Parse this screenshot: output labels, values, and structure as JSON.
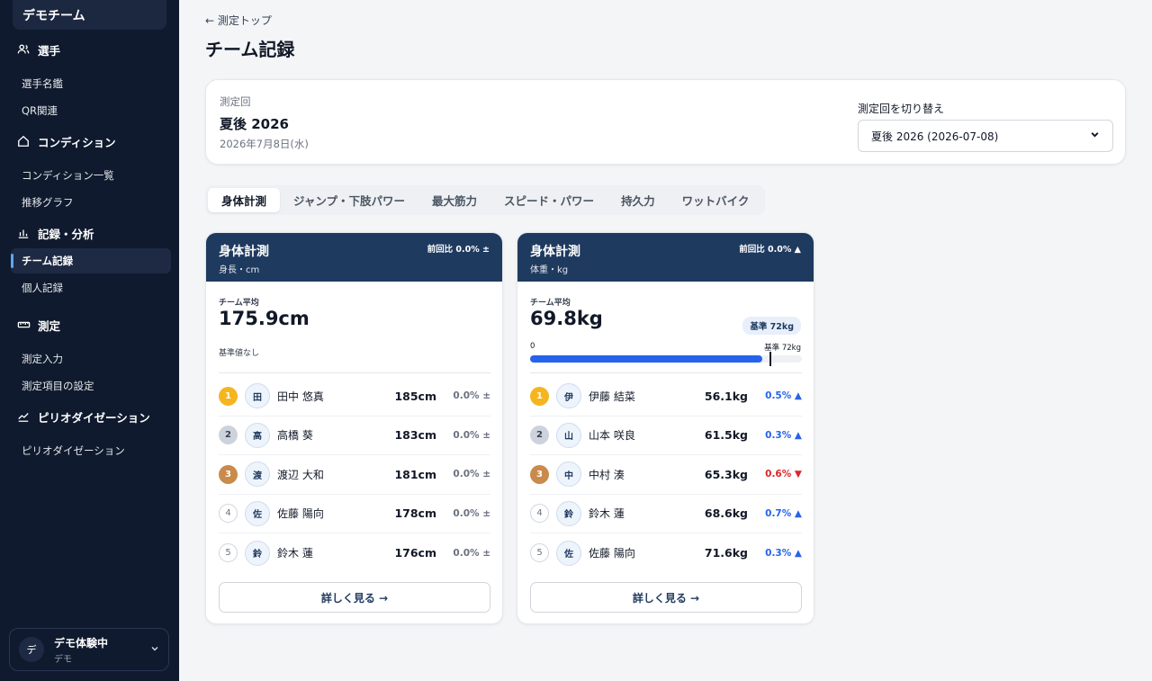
{
  "team": {
    "name": "デモチーム"
  },
  "nav": {
    "sections": [
      {
        "title": "選手",
        "icon": "users-icon",
        "items": [
          "選手名鑑",
          "QR関連"
        ]
      },
      {
        "title": "コンディション",
        "icon": "home-icon",
        "items": [
          "コンディション一覧",
          "推移グラフ"
        ]
      },
      {
        "title": "記録・分析",
        "icon": "bar-chart-icon",
        "items": [
          "チーム記録",
          "個人記録"
        ]
      },
      {
        "title": "測定",
        "icon": "ruler-icon",
        "items": [
          "測定入力",
          "測定項目の設定"
        ]
      },
      {
        "title": "ピリオダイゼーション",
        "icon": "trend-chart-icon",
        "items": [
          "ピリオダイゼーション"
        ]
      }
    ],
    "active_item": "チーム記録"
  },
  "user": {
    "avatar": "デ",
    "name": "デモ体験中",
    "role": "デモ"
  },
  "page": {
    "back_link": "← 測定トップ",
    "title": "チーム記録"
  },
  "session": {
    "label": "測定回",
    "name": "夏後 2026",
    "date": "2026年7月8日(水)",
    "switch_label": "測定回を切り替え",
    "selected": "夏後 2026 (2026-07-08)"
  },
  "tabs": [
    "身体計測",
    "ジャンプ・下肢パワー",
    "最大筋力",
    "スピード・パワー",
    "持久力",
    "ワットバイク"
  ],
  "active_tab": "身体計測",
  "cards": [
    {
      "title": "身体計測",
      "subtitle": "身長・cm",
      "prev_diff": "前回比 0.0% ±",
      "avg_label": "チーム平均",
      "avg_value": "175.9cm",
      "no_standard": "基準値なし",
      "ranking": [
        {
          "rank": "1",
          "initial": "田",
          "name": "田中 悠真",
          "value": "185cm",
          "diff": "0.0% ±",
          "trend": "neutral"
        },
        {
          "rank": "2",
          "initial": "高",
          "name": "高橋 葵",
          "value": "183cm",
          "diff": "0.0% ±",
          "trend": "neutral"
        },
        {
          "rank": "3",
          "initial": "渡",
          "name": "渡辺 大和",
          "value": "181cm",
          "diff": "0.0% ±",
          "trend": "neutral"
        },
        {
          "rank": "4",
          "initial": "佐",
          "name": "佐藤 陽向",
          "value": "178cm",
          "diff": "0.0% ±",
          "trend": "neutral"
        },
        {
          "rank": "5",
          "initial": "鈴",
          "name": "鈴木 蓮",
          "value": "176cm",
          "diff": "0.0% ±",
          "trend": "neutral"
        }
      ],
      "detail_button": "詳しく見る →"
    },
    {
      "title": "身体計測",
      "subtitle": "体重・kg",
      "prev_diff": "前回比 0.0% ▲",
      "avg_label": "チーム平均",
      "avg_value": "69.8kg",
      "standard_badge": "基準 72kg",
      "bar": {
        "min_label": "0",
        "standard_label": "基準 72kg",
        "fill_fraction": 0.855,
        "standard_fraction": 0.882
      },
      "ranking": [
        {
          "rank": "1",
          "initial": "伊",
          "name": "伊藤 結菜",
          "value": "56.1kg",
          "diff": "0.5% ▲",
          "trend": "up"
        },
        {
          "rank": "2",
          "initial": "山",
          "name": "山本 咲良",
          "value": "61.5kg",
          "diff": "0.3% ▲",
          "trend": "up"
        },
        {
          "rank": "3",
          "initial": "中",
          "name": "中村 湊",
          "value": "65.3kg",
          "diff": "0.6% ▼",
          "trend": "down"
        },
        {
          "rank": "4",
          "initial": "鈴",
          "name": "鈴木 蓮",
          "value": "68.6kg",
          "diff": "0.7% ▲",
          "trend": "up"
        },
        {
          "rank": "5",
          "initial": "佐",
          "name": "佐藤 陽向",
          "value": "71.6kg",
          "diff": "0.3% ▲",
          "trend": "up"
        }
      ],
      "detail_button": "詳しく見る →"
    }
  ]
}
